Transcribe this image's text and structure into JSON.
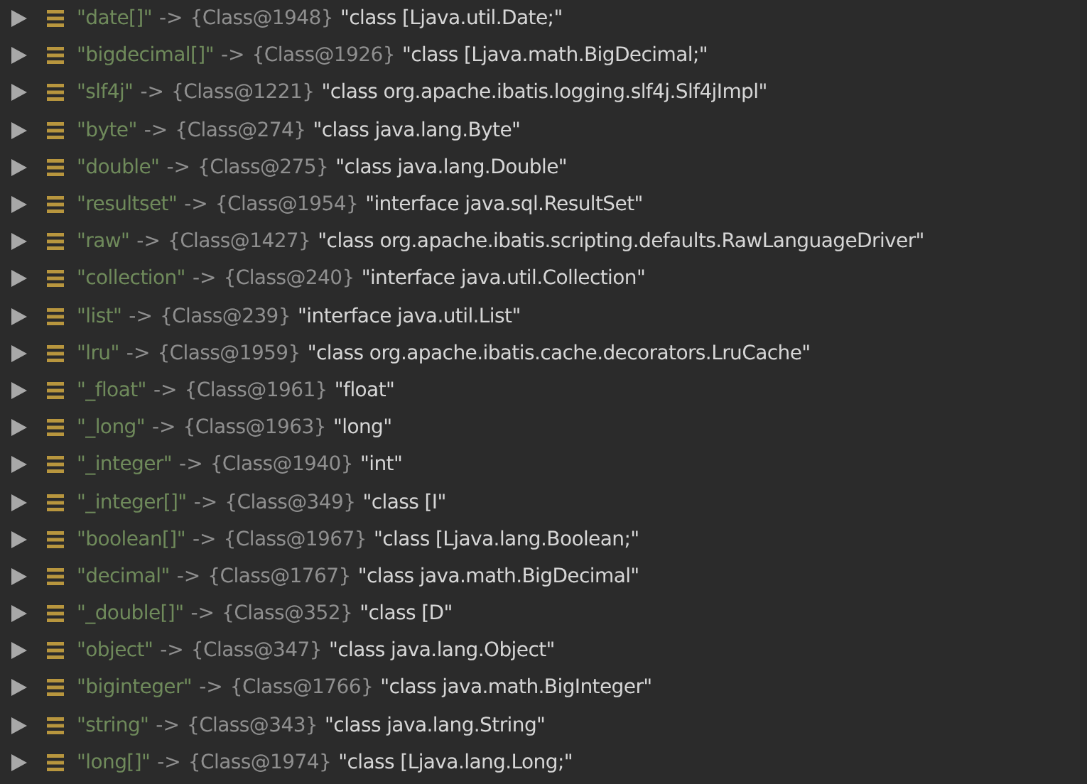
{
  "variables": [
    {
      "key": "\"date[]\"",
      "arrow": "->",
      "ref": "{Class@1948}",
      "value": "\"class [Ljava.util.Date;\""
    },
    {
      "key": "\"bigdecimal[]\"",
      "arrow": "->",
      "ref": "{Class@1926}",
      "value": "\"class [Ljava.math.BigDecimal;\""
    },
    {
      "key": "\"slf4j\"",
      "arrow": "->",
      "ref": "{Class@1221}",
      "value": "\"class org.apache.ibatis.logging.slf4j.Slf4jImpl\""
    },
    {
      "key": "\"byte\"",
      "arrow": "->",
      "ref": "{Class@274}",
      "value": "\"class java.lang.Byte\""
    },
    {
      "key": "\"double\"",
      "arrow": "->",
      "ref": "{Class@275}",
      "value": "\"class java.lang.Double\""
    },
    {
      "key": "\"resultset\"",
      "arrow": "->",
      "ref": "{Class@1954}",
      "value": "\"interface java.sql.ResultSet\""
    },
    {
      "key": "\"raw\"",
      "arrow": "->",
      "ref": "{Class@1427}",
      "value": "\"class org.apache.ibatis.scripting.defaults.RawLanguageDriver\""
    },
    {
      "key": "\"collection\"",
      "arrow": "->",
      "ref": "{Class@240}",
      "value": "\"interface java.util.Collection\""
    },
    {
      "key": "\"list\"",
      "arrow": "->",
      "ref": "{Class@239}",
      "value": "\"interface java.util.List\""
    },
    {
      "key": "\"lru\"",
      "arrow": "->",
      "ref": "{Class@1959}",
      "value": "\"class org.apache.ibatis.cache.decorators.LruCache\""
    },
    {
      "key": "\"_float\"",
      "arrow": "->",
      "ref": "{Class@1961}",
      "value": "\"float\""
    },
    {
      "key": "\"_long\"",
      "arrow": "->",
      "ref": "{Class@1963}",
      "value": "\"long\""
    },
    {
      "key": "\"_integer\"",
      "arrow": "->",
      "ref": "{Class@1940}",
      "value": "\"int\""
    },
    {
      "key": "\"_integer[]\"",
      "arrow": "->",
      "ref": "{Class@349}",
      "value": "\"class [I\""
    },
    {
      "key": "\"boolean[]\"",
      "arrow": "->",
      "ref": "{Class@1967}",
      "value": "\"class [Ljava.lang.Boolean;\""
    },
    {
      "key": "\"decimal\"",
      "arrow": "->",
      "ref": "{Class@1767}",
      "value": "\"class java.math.BigDecimal\""
    },
    {
      "key": "\"_double[]\"",
      "arrow": "->",
      "ref": "{Class@352}",
      "value": "\"class [D\""
    },
    {
      "key": "\"object\"",
      "arrow": "->",
      "ref": "{Class@347}",
      "value": "\"class java.lang.Object\""
    },
    {
      "key": "\"biginteger\"",
      "arrow": "->",
      "ref": "{Class@1766}",
      "value": "\"class java.math.BigInteger\""
    },
    {
      "key": "\"string\"",
      "arrow": "->",
      "ref": "{Class@343}",
      "value": "\"class java.lang.String\""
    },
    {
      "key": "\"long[]\"",
      "arrow": "->",
      "ref": "{Class@1974}",
      "value": "\"class [Ljava.lang.Long;\""
    }
  ]
}
